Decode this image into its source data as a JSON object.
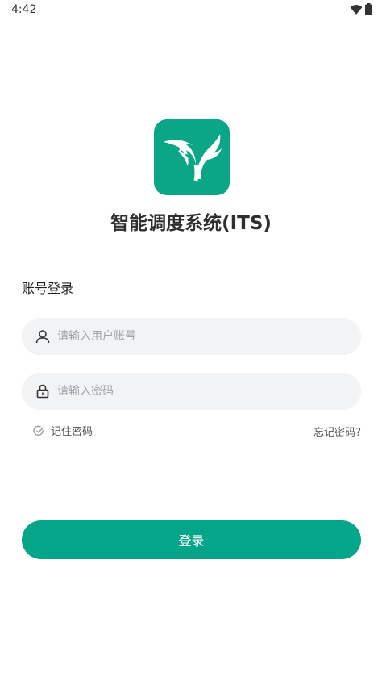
{
  "status_bar": {
    "time": "4:42",
    "icons": [
      "wifi-icon",
      "battery-icon"
    ]
  },
  "app": {
    "title": "智能调度系统(ITS)",
    "brand_color": "#0aa685"
  },
  "login": {
    "section_title": "账号登录",
    "username": {
      "placeholder": "请输入用户账号",
      "value": "",
      "icon": "user-icon"
    },
    "password": {
      "placeholder": "请输入密码",
      "value": "",
      "icon": "lock-icon"
    },
    "remember_label": "记住密码",
    "remember_checked": false,
    "forgot_label": "忘记密码?",
    "submit_label": "登录",
    "button_color": "#05a58a"
  }
}
